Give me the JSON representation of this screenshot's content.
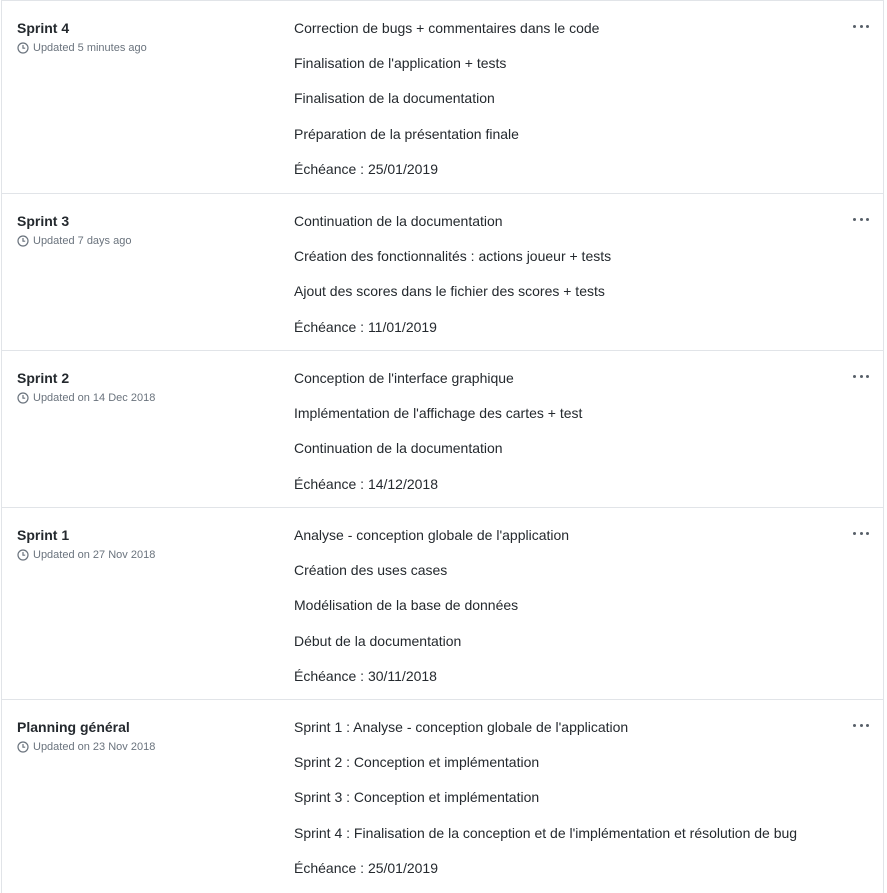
{
  "projects": [
    {
      "title": "Sprint 4",
      "updated": "Updated 5 minutes ago",
      "lines": [
        "Correction de bugs + commentaires dans le code",
        "Finalisation de l'application + tests",
        "Finalisation de la documentation",
        "Préparation de la présentation finale",
        "Échéance : 25/01/2019"
      ]
    },
    {
      "title": "Sprint 3",
      "updated": "Updated 7 days ago",
      "lines": [
        "Continuation de la documentation",
        "Création des fonctionnalités : actions joueur + tests",
        "Ajout des scores dans le fichier des scores + tests",
        "Échéance : 11/01/2019"
      ]
    },
    {
      "title": "Sprint 2",
      "updated": "Updated on 14 Dec 2018",
      "lines": [
        "Conception de l'interface graphique",
        "Implémentation de l'affichage des cartes + test",
        "Continuation de la documentation",
        "Échéance : 14/12/2018"
      ]
    },
    {
      "title": "Sprint 1",
      "updated": "Updated on 27 Nov 2018",
      "lines": [
        "Analyse - conception globale de l'application",
        "Création des uses cases",
        "Modélisation de la base de données",
        "Début de la documentation",
        "Échéance : 30/11/2018"
      ]
    },
    {
      "title": "Planning général",
      "updated": "Updated on 23 Nov 2018",
      "lines": [
        "Sprint 1 : Analyse - conception globale de l'application",
        "Sprint 2 : Conception et implémentation",
        "Sprint 3 : Conception et implémentation",
        "Sprint 4 : Finalisation de la conception et de l'implémentation et résolution de bug",
        "Échéance : 25/01/2019"
      ]
    }
  ],
  "icons": {
    "updated": "clock-icon",
    "menu": "kebab-horizontal-icon"
  },
  "colors": {
    "text": "#24292e",
    "muted": "#6a737d",
    "border": "#e1e4e8"
  }
}
